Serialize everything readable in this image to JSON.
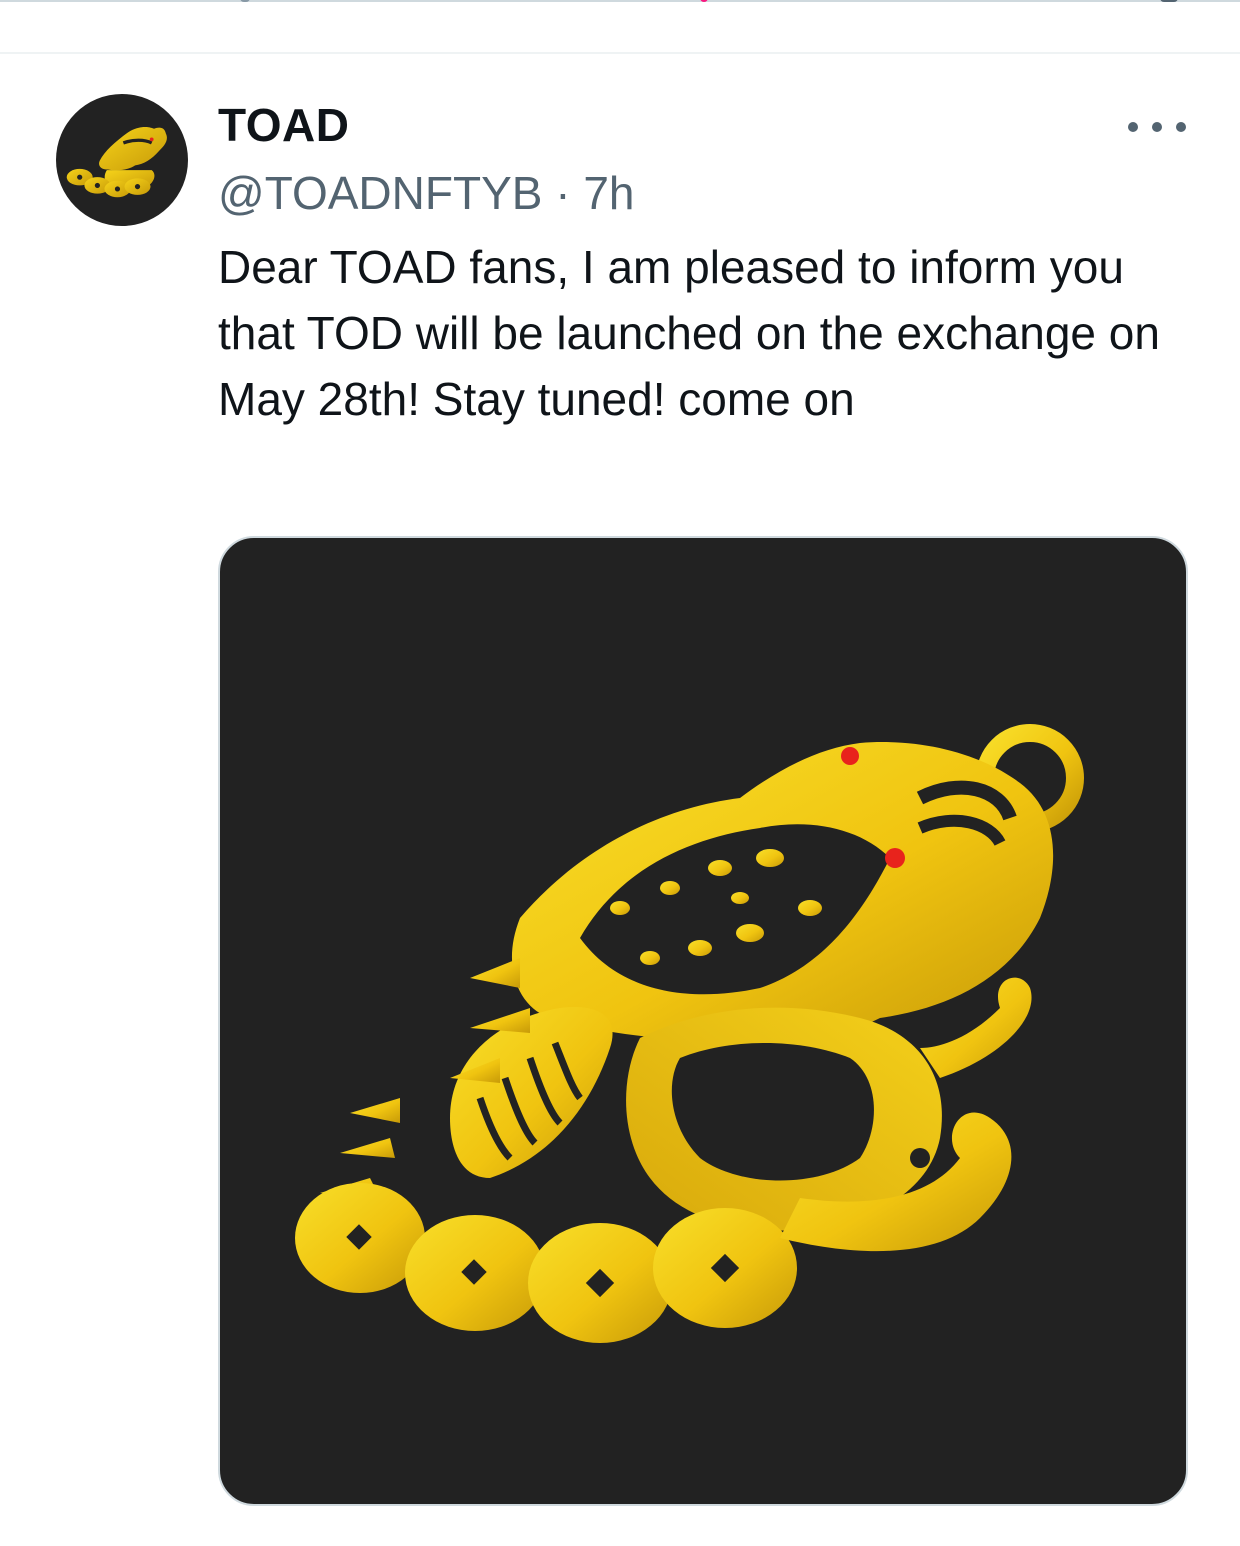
{
  "tweet": {
    "author": {
      "display_name": "TOAD",
      "handle": "@TOADNFTYB",
      "avatar_icon": "golden-toad-logo"
    },
    "separator": "·",
    "timestamp": "7h",
    "more_icon": "ellipsis-icon",
    "text": "Dear TOAD fans, I am pleased to inform you that TOD will be launched on the exchange on May 28th! Stay tuned! come on",
    "media": {
      "type": "image",
      "subject": "golden-toad-logo",
      "background": "#222222"
    }
  },
  "colors": {
    "text_primary": "#0f1419",
    "text_secondary": "#536471",
    "gold": "#f2c811",
    "gold_dark": "#c79a08",
    "eye_red": "#e8231c",
    "media_bg": "#222222"
  }
}
